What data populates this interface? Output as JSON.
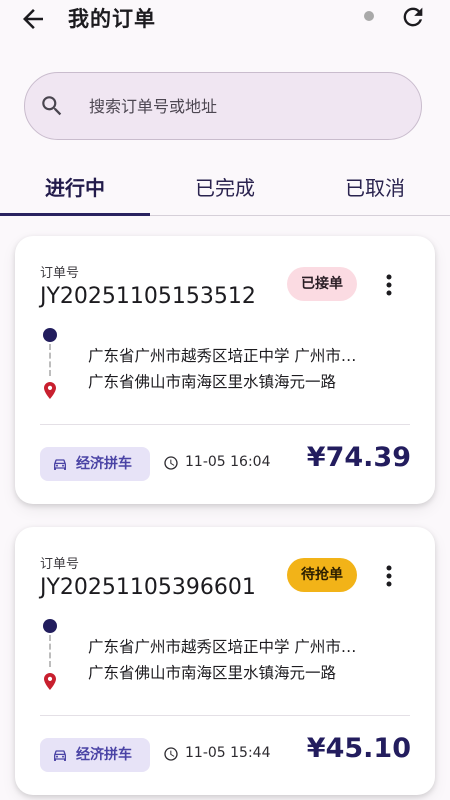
{
  "header": {
    "title": "我的订单",
    "back_icon": "arrow-left-icon",
    "refresh_icon": "refresh-icon"
  },
  "search": {
    "placeholder": "搜索订单号或地址",
    "icon": "search-icon"
  },
  "tabs": [
    {
      "label": "进行中",
      "active": true
    },
    {
      "label": "已完成",
      "active": false
    },
    {
      "label": "已取消",
      "active": false
    }
  ],
  "orders": [
    {
      "label": "订单号",
      "number": "JY20251105153512",
      "status": "已接单",
      "status_color": "#fbdbe2",
      "from": "广东省广州市越秀区培正中学 广州市…",
      "to": "广东省佛山市南海区里水镇海元一路",
      "ride_type": "经济拼车",
      "time": "11-05 16:04",
      "price": "¥74.39"
    },
    {
      "label": "订单号",
      "number": "JY20251105396601",
      "status": "待抢单",
      "status_color": "#f2b318",
      "from": "广东省广州市越秀区培正中学 广州市…",
      "to": "广东省佛山市南海区里水镇海元一路",
      "ride_type": "经济拼车",
      "time": "11-05 15:44",
      "price": "¥45.10"
    }
  ],
  "colors": {
    "accent": "#2a2260",
    "chip_bg": "#e7e3f7",
    "chip_text": "#4a43a5",
    "end_pin": "#c8202f"
  }
}
